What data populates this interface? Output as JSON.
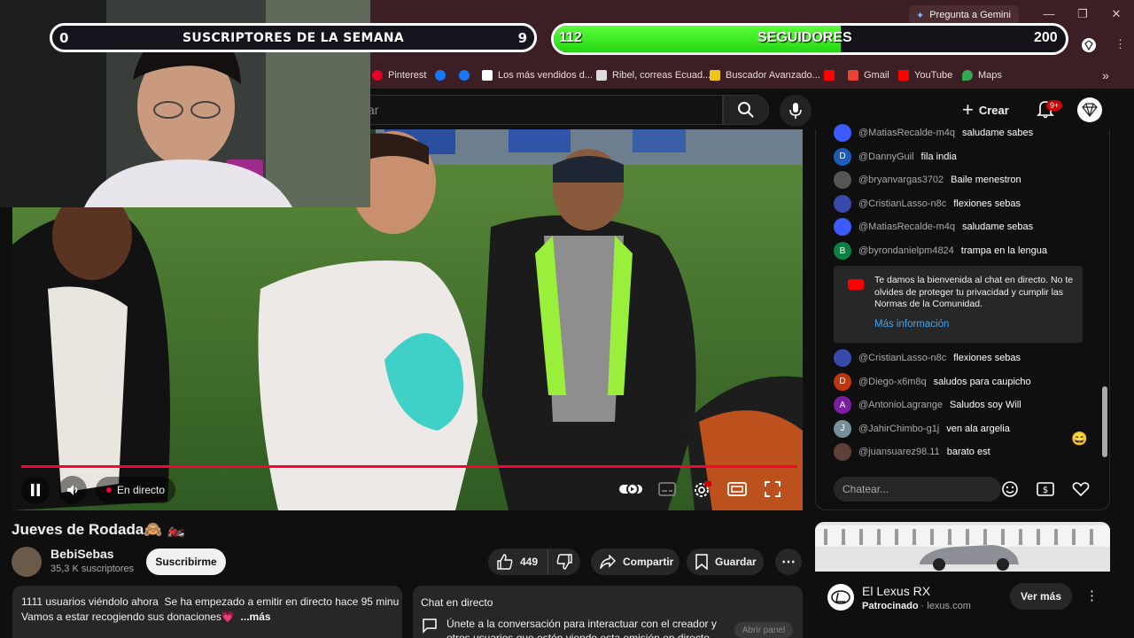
{
  "browser": {
    "gemini_label": "Pregunta a Gemini",
    "search_placeholder": "ar",
    "bookmarks": [
      "Pinterest",
      "Los más vendidos d...",
      "Ribel, correas Ecuad...",
      "Buscador Avanzado...",
      "Gmail",
      "YouTube",
      "Maps"
    ],
    "more_bookmarks": "»"
  },
  "overlay": {
    "subs_left": "0",
    "subs_label": "SUSCRIPTORES DE LA SEMANA",
    "subs_right": "9",
    "followers_current": "112",
    "followers_label": "SEGUIDORES",
    "followers_goal": "200",
    "followers_progress": 0.56
  },
  "header": {
    "create_label": "Crear",
    "notif_badge": "9+"
  },
  "player": {
    "live_label": "En directo",
    "progress": 1.0
  },
  "chat": {
    "messages_top": [
      {
        "author": "@MatiasRecalde-m4q",
        "text": "saludame sabes",
        "avatar": "",
        "color": "#3d5afe"
      },
      {
        "author": "@DannyGuil",
        "text": "fila india",
        "avatar": "D",
        "color": "#1e5bb8"
      },
      {
        "author": "@bryanvargas3702",
        "text": "Baile menestron",
        "avatar": "",
        "color": "#555"
      },
      {
        "author": "@CristianLasso-n8c",
        "text": "flexiones sebas",
        "avatar": "",
        "color": "#3949ab"
      },
      {
        "author": "@MatiasRecalde-m4q",
        "text": "saludame sebas",
        "avatar": "",
        "color": "#3d5afe"
      },
      {
        "author": "@byrondanielpm4824",
        "text": "trampa en la lengua",
        "avatar": "B",
        "color": "#0b8043"
      }
    ],
    "welcome_text": "Te damos la bienvenida al chat en directo. No te olvides de proteger tu privacidad y cumplir las Normas de la Comunidad.",
    "welcome_link": "Más información",
    "messages_bottom": [
      {
        "author": "@CristianLasso-n8c",
        "text": "flexiones sebas",
        "avatar": "",
        "color": "#3949ab"
      },
      {
        "author": "@Diego-x6m8q",
        "text": "saludos para caupicho",
        "avatar": "D",
        "color": "#bf360c"
      },
      {
        "author": "@AntonioLagrange",
        "text": "Saludos soy Will",
        "avatar": "A",
        "color": "#7b1fa2"
      },
      {
        "author": "@JahirChimbo-g1j",
        "text": "ven ala argelia",
        "avatar": "J",
        "color": "#78909c"
      },
      {
        "author": "@juansuarez98.11",
        "text": "barato est",
        "avatar": "",
        "color": "#5d4037"
      }
    ],
    "input_placeholder": "Chatear..."
  },
  "video": {
    "title": "Jueves de Rodada🙈 🏍️",
    "channel": "BebiSebas",
    "subscribers": "35,3 K suscriptores",
    "subscribe_label": "Suscribirme",
    "likes": "449",
    "share_label": "Compartir",
    "save_label": "Guardar"
  },
  "description": {
    "viewers": "1111 usuarios viéndolo ahora",
    "started": "Se ha empezado a emitir en directo hace 95 minu",
    "line2": "Vamos a estar recogiendo sus donaciones💗",
    "more": "...más"
  },
  "live_chat_panel": {
    "title": "Chat en directo",
    "text1": "Únete a la conversación para interactuar con el creador y",
    "text2": "otros usuarios que estén viendo esta emisión en directo.",
    "open_label": "Abrir panel"
  },
  "ad": {
    "title": "El Lexus RX",
    "sponsored": "Patrocinado",
    "domain": "lexus.com",
    "cta": "Ver más"
  }
}
